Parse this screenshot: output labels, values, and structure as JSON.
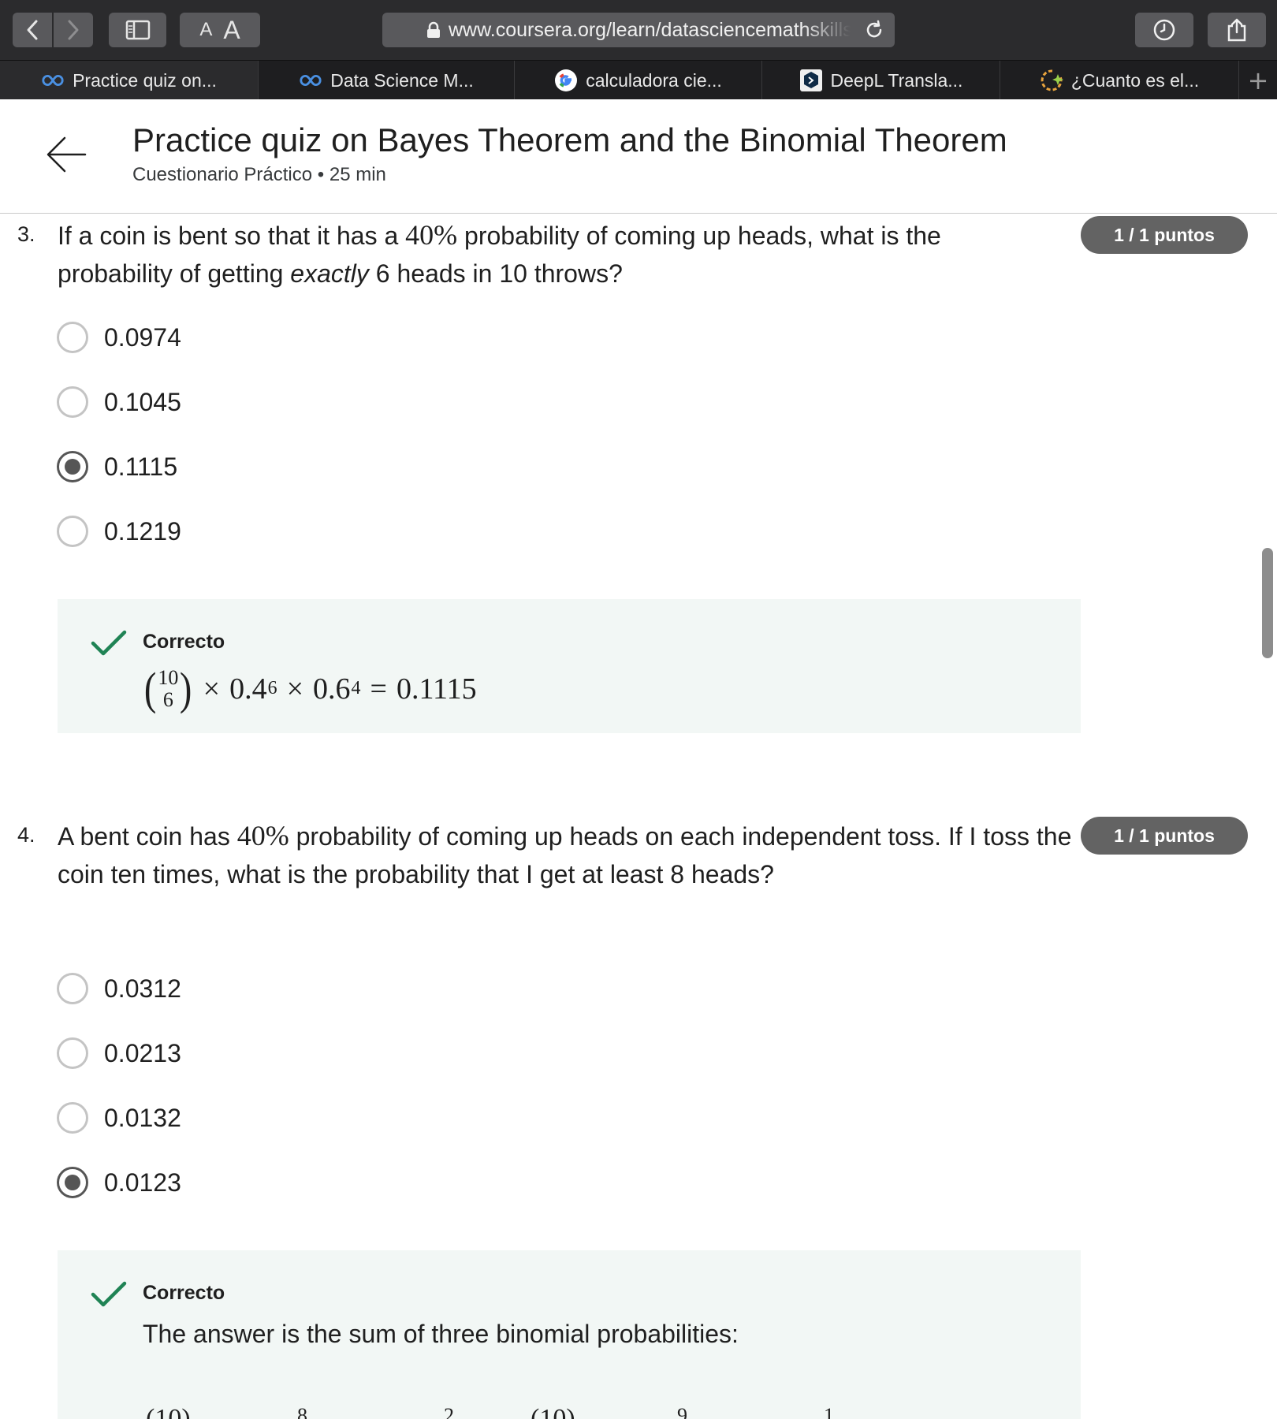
{
  "browser": {
    "url": "www.coursera.org/learn/datasciencemathskills",
    "text_size_small": "A",
    "text_size_large": "A",
    "tabs": [
      {
        "label": "Practice quiz on...",
        "icon": "coursera-icon",
        "active": true
      },
      {
        "label": "Data Science M...",
        "icon": "coursera-icon",
        "active": false
      },
      {
        "label": "calculadora cie...",
        "icon": "google-icon",
        "active": false
      },
      {
        "label": "DeepL Transla...",
        "icon": "deepl-icon",
        "active": false
      },
      {
        "label": "¿Cuanto es el...",
        "icon": "sparkle-icon",
        "active": false
      }
    ],
    "new_tab": "+"
  },
  "header": {
    "title": "Practice quiz on Bayes Theorem and the Binomial Theorem",
    "subtitle": "Cuestionario Práctico • 25 min"
  },
  "questions": [
    {
      "number": "3.",
      "text_part1": "If a coin is bent so that it has a ",
      "math1": "40%",
      "text_part2": " probability of coming up heads, what is the probability of getting ",
      "emphasis": "exactly",
      "text_part3": " 6 heads in 10 throws?",
      "points": "1 / 1 puntos",
      "options": [
        {
          "label": "0.0974",
          "selected": false
        },
        {
          "label": "0.1045",
          "selected": false
        },
        {
          "label": "0.1115",
          "selected": true
        },
        {
          "label": "0.1219",
          "selected": false
        }
      ],
      "feedback": {
        "status": "Correcto",
        "formula": {
          "binom_top": "10",
          "binom_bottom": "6",
          "times1": "×",
          "base1": "0.4",
          "exp1": "6",
          "times2": "×",
          "base2": "0.6",
          "exp2": "4",
          "equals": "=",
          "result": "0.1115"
        }
      }
    },
    {
      "number": "4.",
      "text_part1": "A bent coin has ",
      "math1": "40%",
      "text_part2": " probability of coming up heads on each independent toss. If I toss the coin ten times, what is the probability that I get at least 8 heads?",
      "points": "1 / 1 puntos",
      "options": [
        {
          "label": "0.0312",
          "selected": false
        },
        {
          "label": "0.0213",
          "selected": false
        },
        {
          "label": "0.0132",
          "selected": false
        },
        {
          "label": "0.0123",
          "selected": true
        }
      ],
      "feedback": {
        "status": "Correcto",
        "text": "The answer is the sum of three binomial probabilities:",
        "partial_formula": {
          "top_left": "(10)",
          "top_8": "8",
          "top_2": "2",
          "top_right": "(10)",
          "top_9": "9",
          "top_1": "1"
        }
      }
    }
  ],
  "colors": {
    "badge_bg": "#636363",
    "feedback_bg": "#f2f7f5",
    "check_green": "#1f8354"
  }
}
